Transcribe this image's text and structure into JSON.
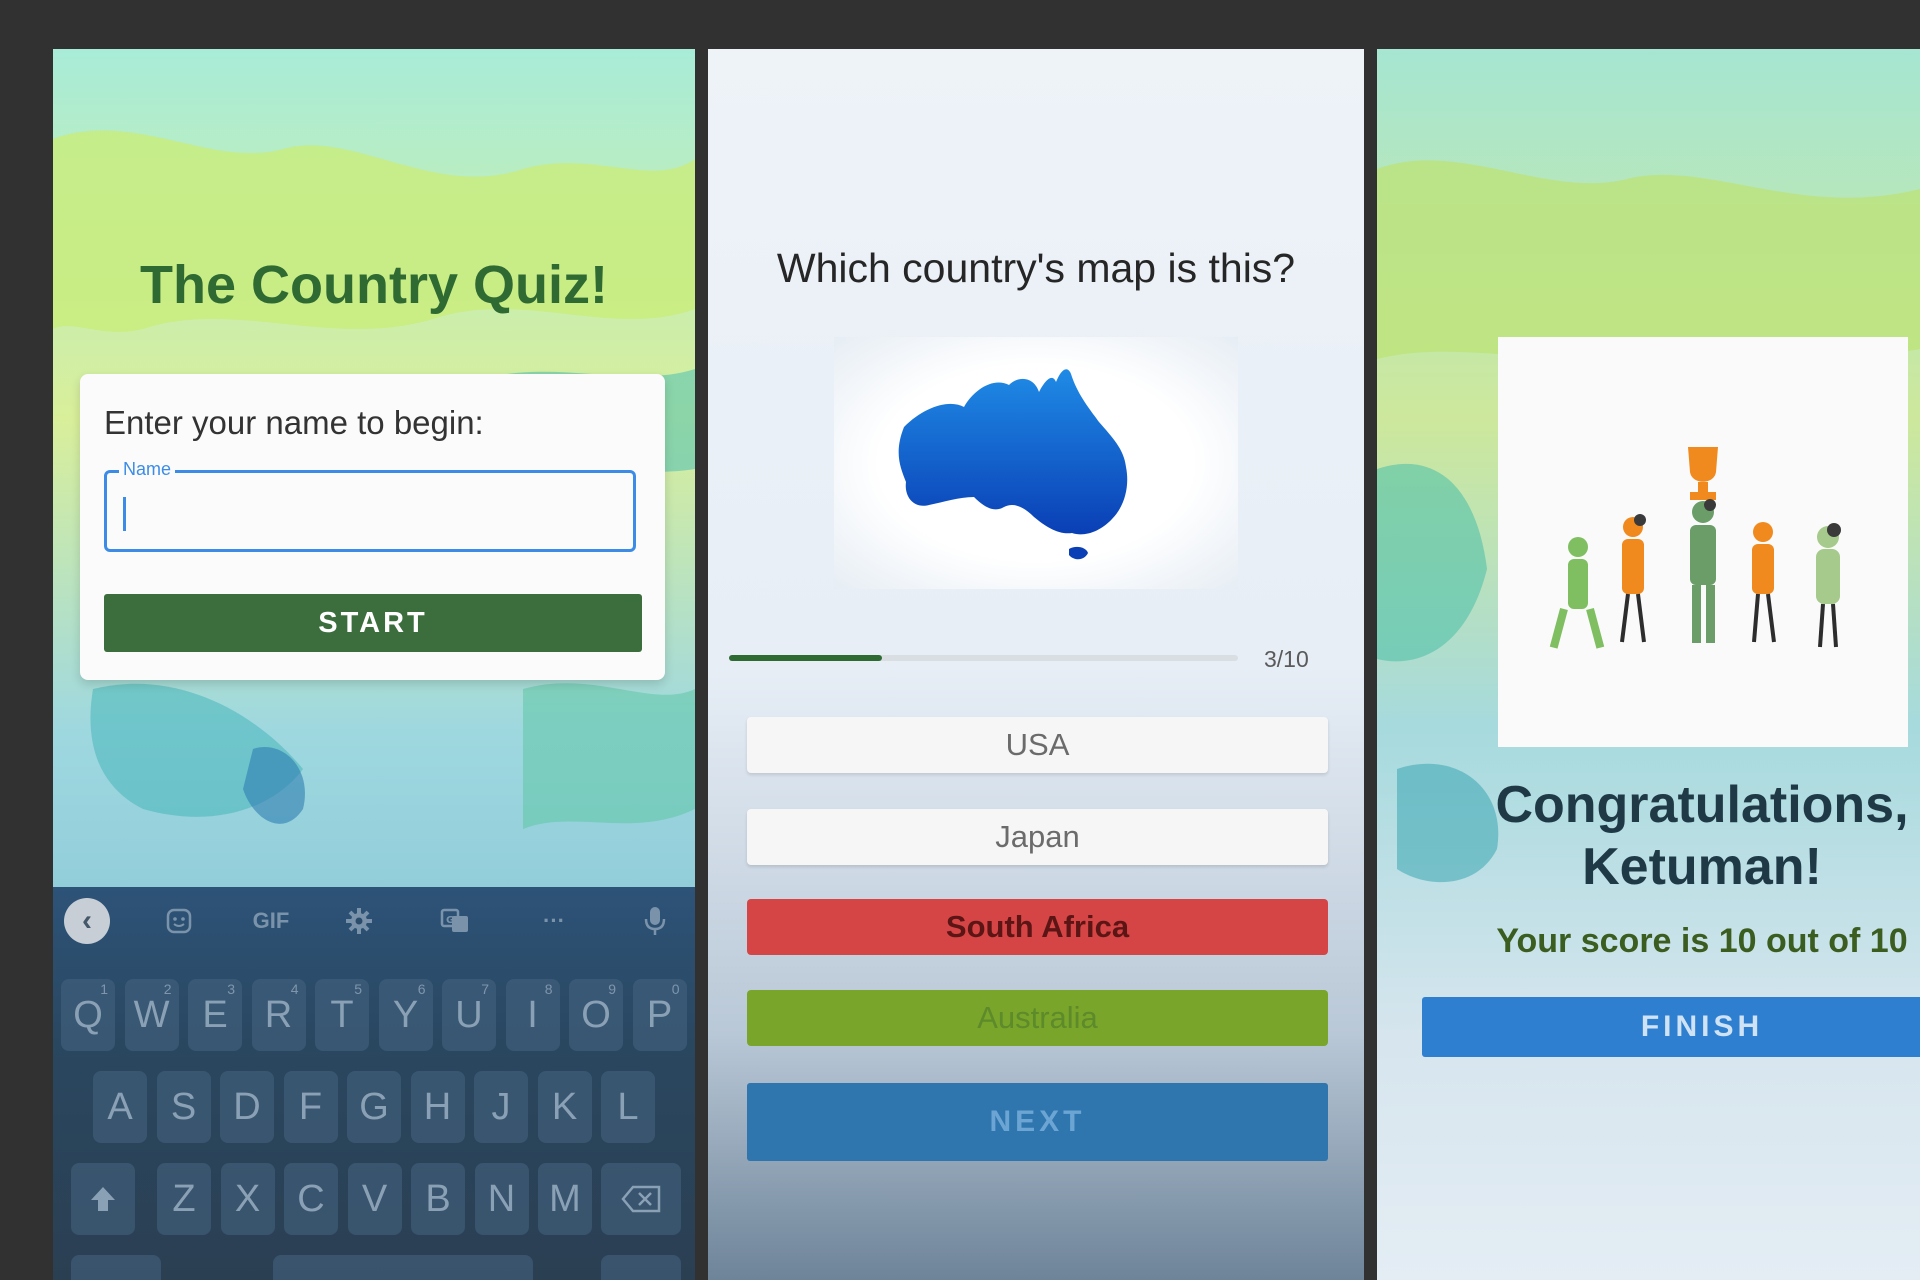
{
  "start_screen": {
    "title": "The Country Quiz!",
    "prompt": "Enter your name to begin:",
    "name_field": {
      "label": "Name",
      "value": ""
    },
    "start_label": "START",
    "keyboard": {
      "toolbar": {
        "back_icon": "‹",
        "gif_label": "GIF",
        "more_label": "···"
      },
      "row1": [
        {
          "key": "Q",
          "hint": "1"
        },
        {
          "key": "W",
          "hint": "2"
        },
        {
          "key": "E",
          "hint": "3"
        },
        {
          "key": "R",
          "hint": "4"
        },
        {
          "key": "T",
          "hint": "5"
        },
        {
          "key": "Y",
          "hint": "6"
        },
        {
          "key": "U",
          "hint": "7"
        },
        {
          "key": "I",
          "hint": "8"
        },
        {
          "key": "O",
          "hint": "9"
        },
        {
          "key": "P",
          "hint": "0"
        }
      ],
      "row2": [
        "A",
        "S",
        "D",
        "F",
        "G",
        "H",
        "J",
        "K",
        "L"
      ],
      "row3": [
        "Z",
        "X",
        "C",
        "V",
        "B",
        "N",
        "M"
      ]
    }
  },
  "question_screen": {
    "question": "Which country's map is this?",
    "progress": {
      "current": 3,
      "total": 10,
      "label": "3/10"
    },
    "options": [
      {
        "label": "USA",
        "state": "neutral"
      },
      {
        "label": "Japan",
        "state": "neutral"
      },
      {
        "label": "South Africa",
        "state": "wrong"
      },
      {
        "label": "Australia",
        "state": "correct"
      }
    ],
    "next_label": "NEXT"
  },
  "result_screen": {
    "congrats_line1": "Congratulations,",
    "congrats_line2": "Ketuman!",
    "score_text": "Your score is 10 out of 10",
    "finish_label": "FINISH"
  },
  "colors": {
    "primary_green": "#3b6e3c",
    "accent_blue": "#3c8ce7",
    "wrong_red": "#d64545",
    "correct_green": "#79a52a",
    "next_blue": "#2f75ae"
  }
}
